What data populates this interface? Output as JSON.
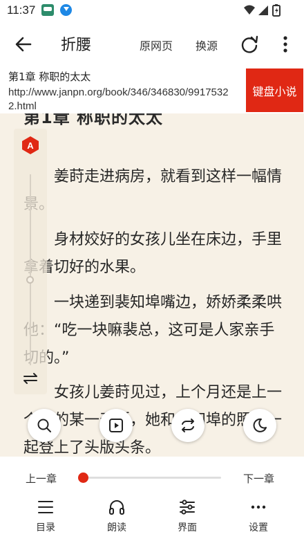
{
  "status_bar": {
    "time": "11:37",
    "icons": [
      "app-notification-icon",
      "download-notification-icon",
      "wifi-icon",
      "signal-icon",
      "battery-charging-icon"
    ]
  },
  "toolbar": {
    "back_icon": "back-arrow-icon",
    "title": "折腰",
    "origin_label": "原网页",
    "switch_source_label": "换源",
    "refresh_icon": "refresh-icon",
    "more_icon": "more-vertical-icon"
  },
  "url_header": {
    "chapter": "第1章 称职的太太",
    "url": "http://www.janpn.org/book/346/346830/99175322.html",
    "source_button": "键盘小说"
  },
  "reader": {
    "partial_heading": "第1章 称职的太太",
    "paragraphs": [
      "姜莳走进病房，就看到这样一幅情景。",
      "身材姣好的女孩儿坐在床边，手里拿着切好的水果。",
      "一块递到裴知埠嘴边，娇娇柔柔哄他：“吃一块嘛裴总，这可是人家亲手切的。”",
      "女孩儿姜莳见过，上个月还是上一个月的某一天版，她和裴知埠的照片一起登上了头版头条。"
    ]
  },
  "side_controls": {
    "auto_icon": "auto-page-icon",
    "swap_icon": "swap-orientation-icon"
  },
  "floating_buttons": [
    {
      "icon": "search-icon"
    },
    {
      "icon": "auto-play-icon"
    },
    {
      "icon": "replace-icon"
    },
    {
      "icon": "night-mode-icon"
    }
  ],
  "bottom_panel": {
    "prev_chapter": "上一章",
    "next_chapter": "下一章",
    "progress": 0,
    "accent": "#e02814",
    "items": [
      {
        "label": "目录",
        "icon": "catalog-icon"
      },
      {
        "label": "朗读",
        "icon": "headphones-icon"
      },
      {
        "label": "界面",
        "icon": "interface-sliders-icon"
      },
      {
        "label": "设置",
        "icon": "settings-more-icon"
      }
    ]
  }
}
